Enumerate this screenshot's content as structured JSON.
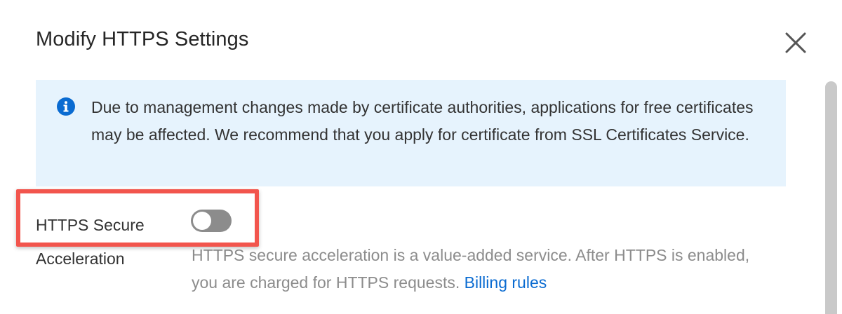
{
  "dialog": {
    "title": "Modify HTTPS Settings"
  },
  "notice": {
    "icon": "info-icon",
    "text": "Due to management changes made by certificate authorities, applications for free certificates may be affected. We recommend that you apply for certificate from SSL Certificates Service."
  },
  "https_secure": {
    "label_line1": "HTTPS Secure",
    "label_line2": "Acceleration",
    "toggle_state": "off",
    "description": "HTTPS secure acceleration is a value-added service. After HTTPS is enabled, you are charged for HTTPS requests.",
    "link_label": "Billing rules"
  },
  "colors": {
    "notice_bg": "#e6f3fd",
    "info_icon": "#0a6bd1",
    "link": "#0a6bd1",
    "toggle_off": "#8c8c8c",
    "highlight_box": "#f2554d"
  }
}
